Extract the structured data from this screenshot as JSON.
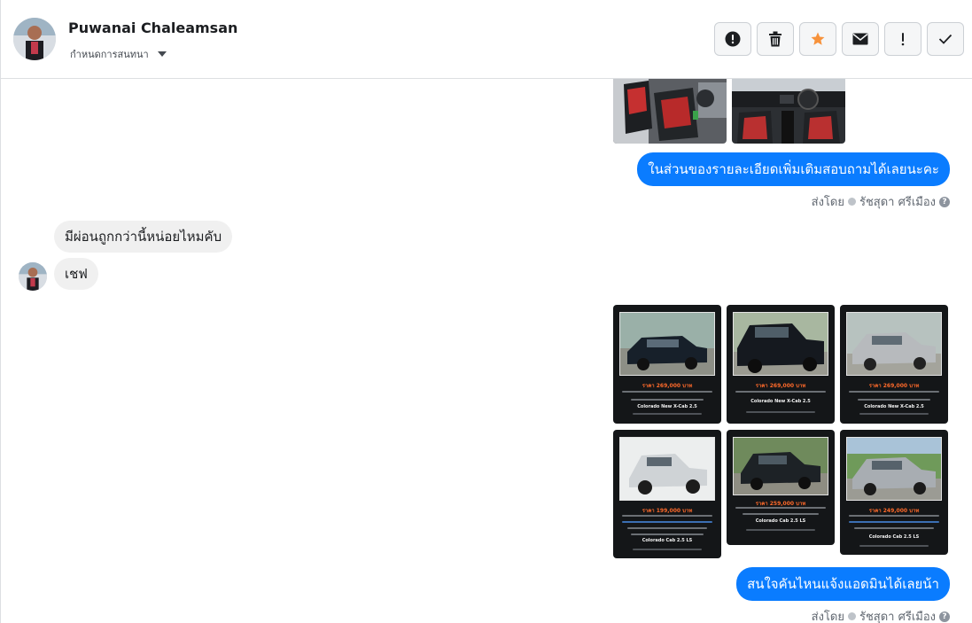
{
  "header": {
    "name": "Puwanai Chaleamsan",
    "subtitle": "กำหนดการสนทนา",
    "actions": [
      {
        "name": "alert-circle-icon",
        "label": "report"
      },
      {
        "name": "trash-icon",
        "label": "delete"
      },
      {
        "name": "star-icon",
        "label": "star"
      },
      {
        "name": "envelope-icon",
        "label": "mark unread"
      },
      {
        "name": "exclamation-icon",
        "label": "spam"
      },
      {
        "name": "checkmark-icon",
        "label": "done"
      }
    ],
    "colors": {
      "star": "#f7923b"
    }
  },
  "messages": {
    "out1": "ในส่วนของรายละเอียดเพิ่มเติมสอบถามได้เลยนะคะ",
    "sent_by_label": "ส่งโดย",
    "sent_by_name": "รัชสุดา ศรีเมือง",
    "in1": "มีผ่อนถูกกว่านี้หน่อยไหมคับ",
    "in2": "เชฟ",
    "out2": "สนใจคันไหนแจ้งแอดมินได้เลยน้า"
  },
  "cars": [
    {
      "price": "ราคา 269,000 บาท",
      "model": "Colorado New X-Cab 2.5"
    },
    {
      "price": "ราคา 269,000 บาท",
      "model": "Colorado New X-Cab 2.5"
    },
    {
      "price": "ราคา 269,000 บาท",
      "model": "Colorado New X-Cab 2.5"
    },
    {
      "price": "ราคา 199,000 บาท",
      "model": "Colorado Cab 2.5 LS"
    },
    {
      "price": "ราคา 259,000 บาท",
      "model": "Colorado Cab 2.5 LS"
    },
    {
      "price": "ราคา 249,000 บาท",
      "model": "Colorado Cab 2.5 LS"
    }
  ],
  "theme": {
    "bubble_out": "#0a7cff",
    "bubble_in": "#f0f0f0"
  }
}
